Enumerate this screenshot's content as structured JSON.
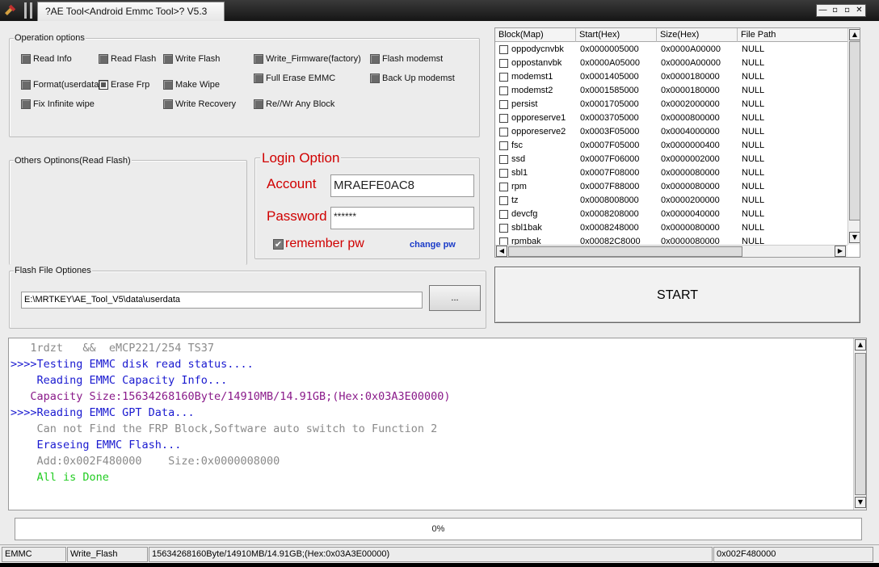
{
  "window": {
    "title": "?AE Tool<Android Emmc Tool>? V5.3",
    "controls": [
      "‸",
      "▫",
      "▫",
      "✕"
    ]
  },
  "operation_options": {
    "label": "Operation options",
    "items": [
      {
        "label": "Read Info",
        "selected": false
      },
      {
        "label": "Read Flash",
        "selected": false
      },
      {
        "label": "Write Flash",
        "selected": false
      },
      {
        "label": "Write_Firmware(factory)",
        "selected": false
      },
      {
        "label": "Flash modemst",
        "selected": false
      },
      {
        "label": "Format(userdata)",
        "selected": false
      },
      {
        "label": "Erase Frp",
        "selected": true
      },
      {
        "label": "Make Wipe",
        "selected": false
      },
      {
        "label": "Full Erase EMMC",
        "selected": false
      },
      {
        "label": "Back Up modemst",
        "selected": false
      },
      {
        "label": "Fix Infinite wipe",
        "selected": false
      },
      {
        "label": "Write Recovery",
        "selected": false
      },
      {
        "label": "Re//Wr Any Block",
        "selected": false
      }
    ]
  },
  "others_options": {
    "label": "Others Optinons(Read Flash)"
  },
  "login": {
    "title": "Login Option",
    "account_label": "Account",
    "account_value": "MRAEFE0AC8",
    "password_label": "Password",
    "password_value": "******",
    "remember_label": "remember pw",
    "remember_checked": true,
    "change_pw": "change pw"
  },
  "flash_file": {
    "label": "Flash File Optiones",
    "path": "E:\\MRTKEY\\AE_Tool_V5\\data\\userdata",
    "browse_label": "..."
  },
  "block_table": {
    "headers": [
      "Block(Map)",
      "Start(Hex)",
      "Size(Hex)",
      "File Path"
    ],
    "rows": [
      [
        "oppodycnvbk",
        "0x0000005000",
        "0x0000A00000",
        "NULL"
      ],
      [
        "oppostanvbk",
        "0x0000A05000",
        "0x0000A00000",
        "NULL"
      ],
      [
        "modemst1",
        "0x0001405000",
        "0x0000180000",
        "NULL"
      ],
      [
        "modemst2",
        "0x0001585000",
        "0x0000180000",
        "NULL"
      ],
      [
        "persist",
        "0x0001705000",
        "0x0002000000",
        "NULL"
      ],
      [
        "opporeserve1",
        "0x0003705000",
        "0x0000800000",
        "NULL"
      ],
      [
        "opporeserve2",
        "0x0003F05000",
        "0x0004000000",
        "NULL"
      ],
      [
        "fsc",
        "0x0007F05000",
        "0x0000000400",
        "NULL"
      ],
      [
        "ssd",
        "0x0007F06000",
        "0x0000002000",
        "NULL"
      ],
      [
        "sbl1",
        "0x0007F08000",
        "0x0000080000",
        "NULL"
      ],
      [
        "rpm",
        "0x0007F88000",
        "0x0000080000",
        "NULL"
      ],
      [
        "tz",
        "0x0008008000",
        "0x0000200000",
        "NULL"
      ],
      [
        "devcfg",
        "0x0008208000",
        "0x0000040000",
        "NULL"
      ],
      [
        "sbl1bak",
        "0x0008248000",
        "0x0000080000",
        "NULL"
      ],
      [
        "rpmbak",
        "0x00082C8000",
        "0x0000080000",
        "NULL"
      ]
    ]
  },
  "start_button": "START",
  "log": {
    "lines": [
      {
        "text": "   1rdzt   &&  eMCP221/254 TS37",
        "color": "#8a8a8a"
      },
      {
        "text": ">>>>Testing EMMC disk read status....",
        "color": "#1a1ad0"
      },
      {
        "text": "    Reading EMMC Capacity Info...",
        "color": "#1a1ad0"
      },
      {
        "text": "   Capacity Size:15634268160Byte/14910MB/14.91GB;(Hex:0x03A3E00000)",
        "color": "#8a1a8a"
      },
      {
        "text": ">>>>Reading EMMC GPT Data...",
        "color": "#1a1ad0"
      },
      {
        "text": "    Can not Find the FRP Block,Software auto switch to Function 2",
        "color": "#8a8a8a"
      },
      {
        "text": "    Eraseing EMMC Flash...",
        "color": "#1a1ad0"
      },
      {
        "text": "    Add:0x002F480000    Size:0x0000008000",
        "color": "#8a8a8a"
      },
      {
        "text": "    All is Done",
        "color": "#22cc22"
      }
    ]
  },
  "progress": {
    "value": 0,
    "text": "0%"
  },
  "statusbar": {
    "device": "EMMC",
    "mode": "Write_Flash",
    "capacity": "15634268160Byte/14910MB/14.91GB;(Hex:0x03A3E00000)",
    "address": "0x002F480000"
  }
}
